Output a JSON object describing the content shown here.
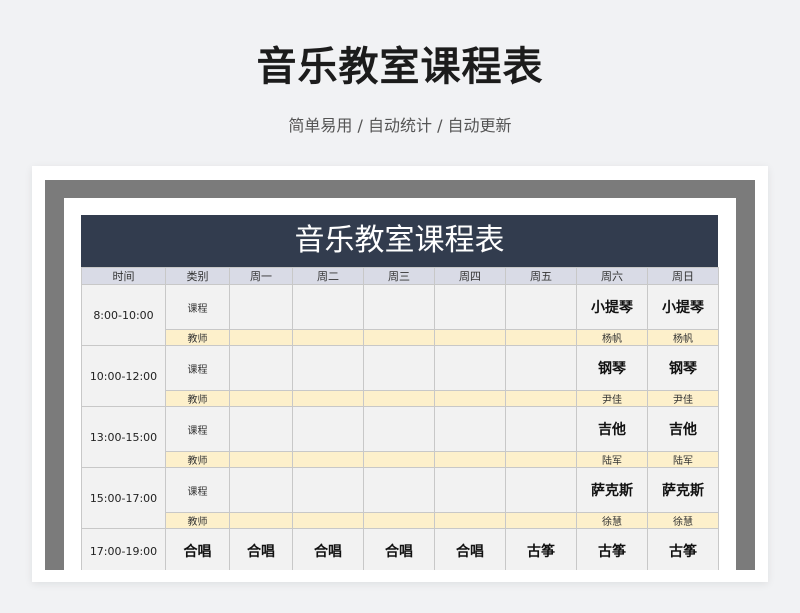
{
  "page": {
    "title": "音乐教室课程表",
    "subtitle": "简单易用  /  自动统计  /  自动更新"
  },
  "schedule": {
    "banner": "音乐教室课程表",
    "headers": [
      "时间",
      "类别",
      "周一",
      "周二",
      "周三",
      "周四",
      "周五",
      "周六",
      "周日"
    ],
    "course_label": "课程",
    "teacher_label": "教师",
    "slots": [
      {
        "time": "8:00-10:00",
        "courses": [
          "",
          "",
          "",
          "",
          "",
          "小提琴",
          "小提琴"
        ],
        "teachers": [
          "",
          "",
          "",
          "",
          "",
          "杨帆",
          "杨帆"
        ]
      },
      {
        "time": "10:00-12:00",
        "courses": [
          "",
          "",
          "",
          "",
          "",
          "钢琴",
          "钢琴"
        ],
        "teachers": [
          "",
          "",
          "",
          "",
          "",
          "尹佳",
          "尹佳"
        ]
      },
      {
        "time": "13:00-15:00",
        "courses": [
          "",
          "",
          "",
          "",
          "",
          "吉他",
          "吉他"
        ],
        "teachers": [
          "",
          "",
          "",
          "",
          "",
          "陆军",
          "陆军"
        ]
      },
      {
        "time": "15:00-17:00",
        "courses": [
          "",
          "",
          "",
          "",
          "",
          "萨克斯",
          "萨克斯"
        ],
        "teachers": [
          "",
          "",
          "",
          "",
          "",
          "徐慧",
          "徐慧"
        ]
      },
      {
        "time": "17:00-19:00",
        "courses": [
          "合唱",
          "合唱",
          "合唱",
          "合唱",
          "合唱",
          "古筝",
          "古筝"
        ],
        "teachers": [
          "",
          "",
          "",
          "",
          "",
          "",
          ""
        ]
      }
    ]
  },
  "colors": {
    "banner_bg": "#323c4e",
    "header_bg": "#d9dbe6",
    "teacher_row_bg": "#fdf0cb",
    "cell_bg": "#f2f2f2",
    "frame_bg": "#7b7b7b"
  }
}
